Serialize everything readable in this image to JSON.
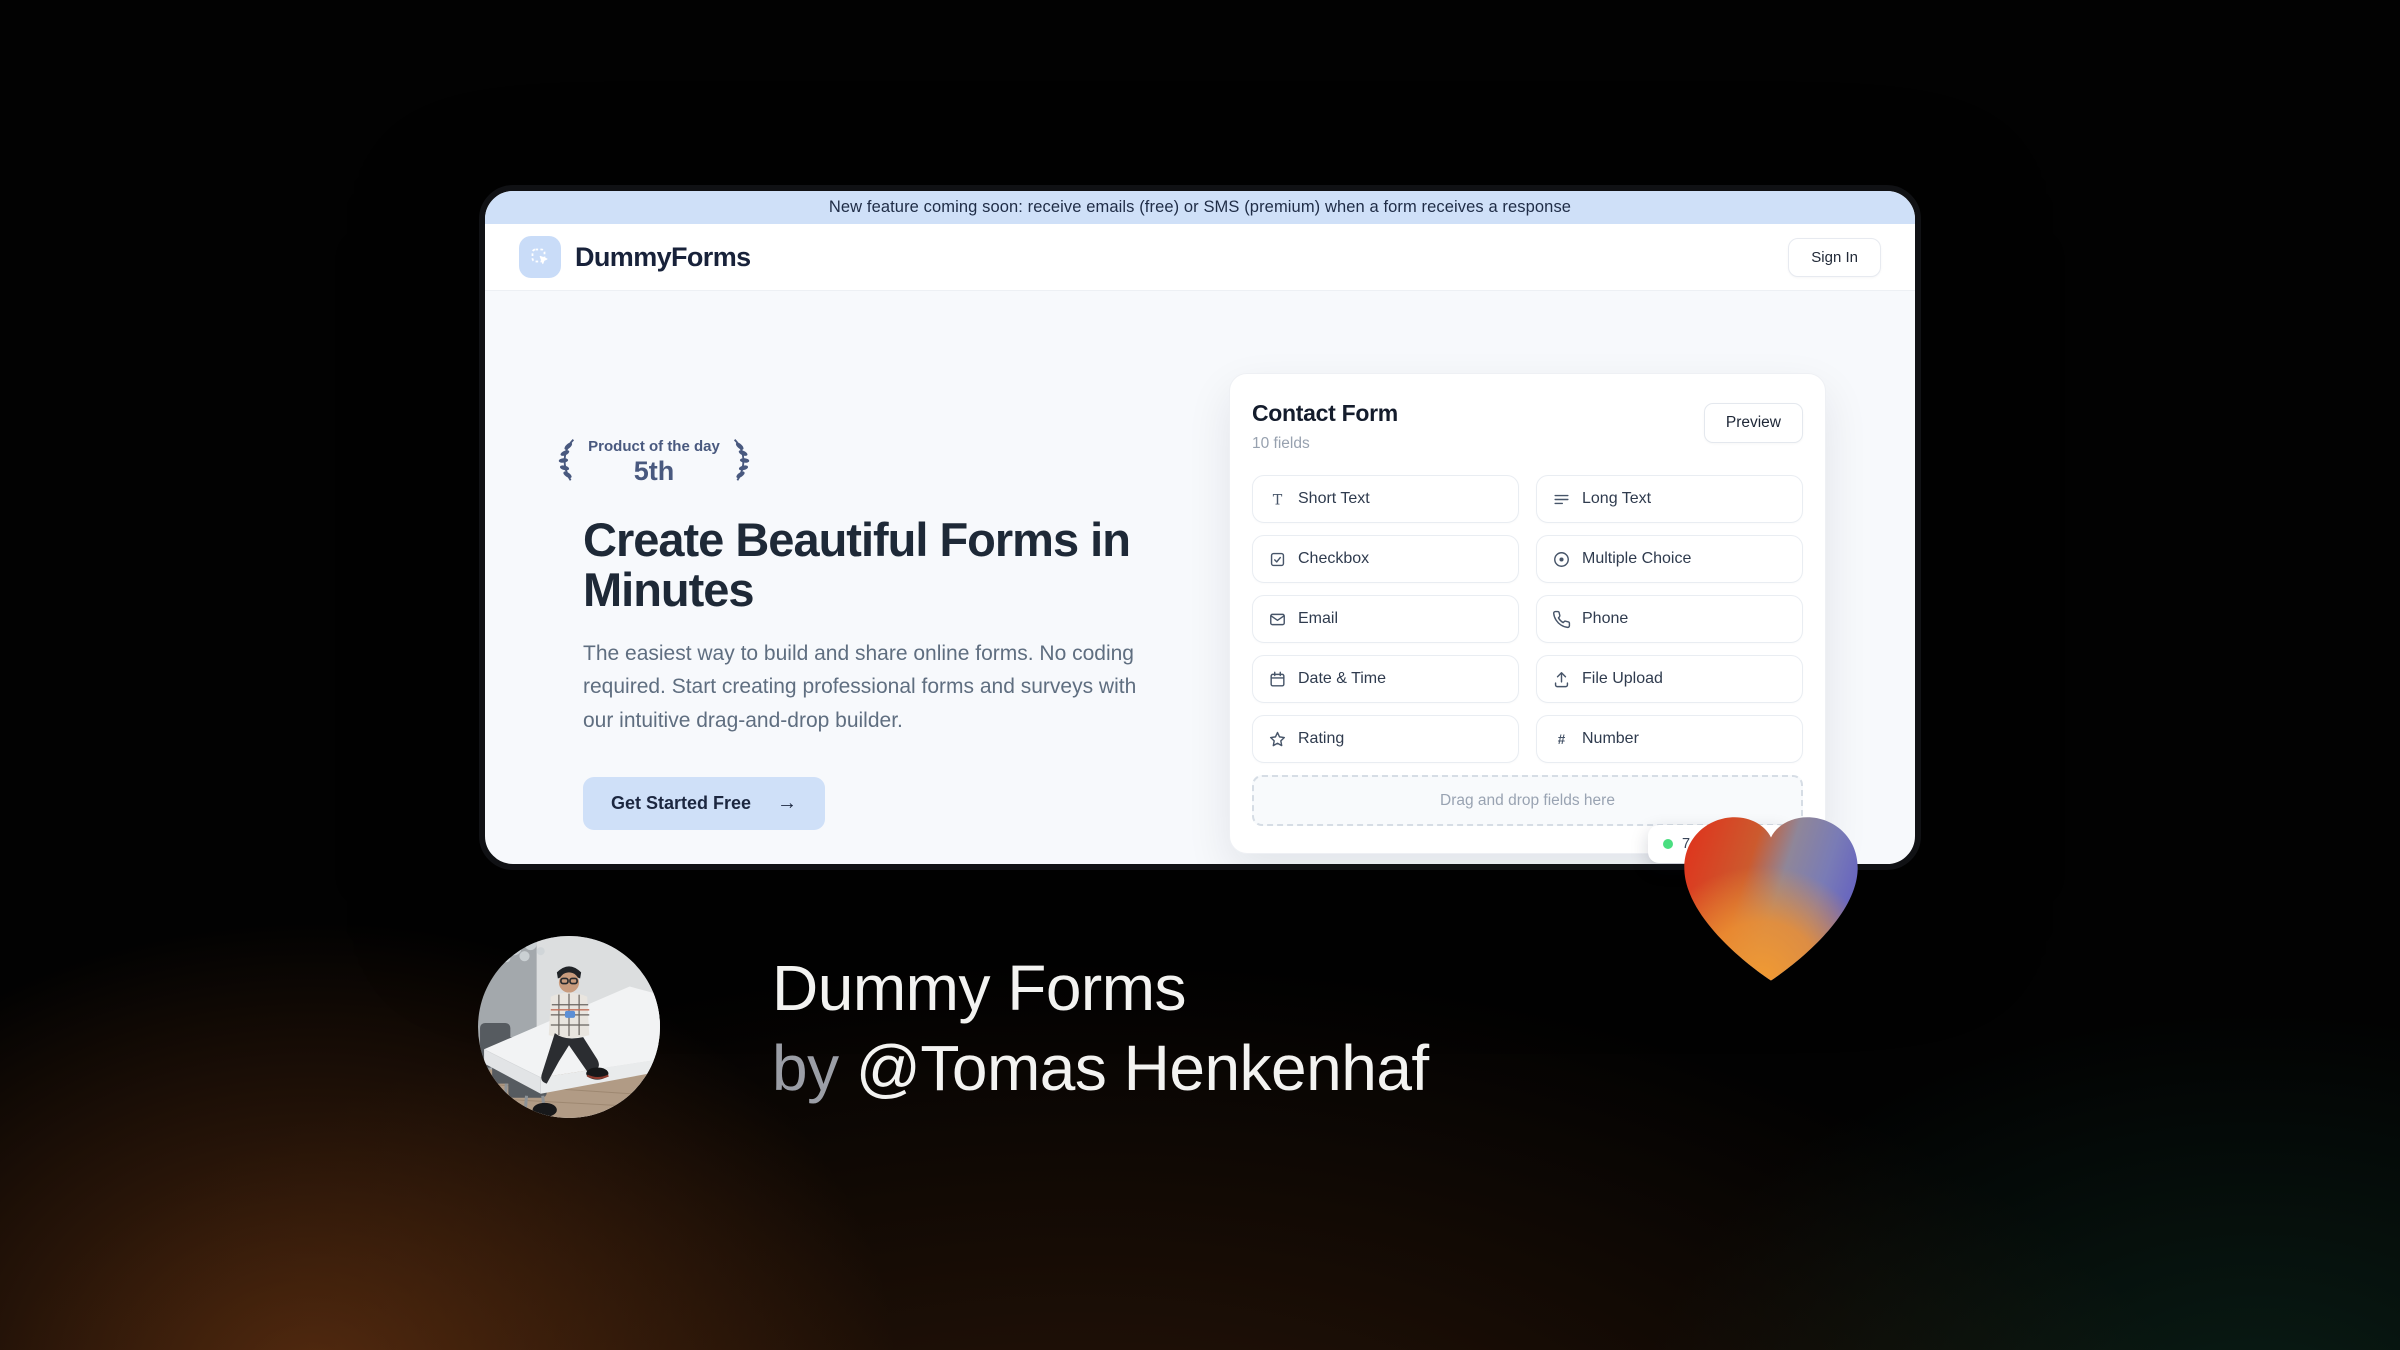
{
  "banner": {
    "text": "New feature coming soon: receive emails (free) or SMS (premium) when a form receives a response"
  },
  "header": {
    "brand": "DummyForms",
    "sign_in_label": "Sign In"
  },
  "hero": {
    "award": {
      "title": "Product of the day",
      "rank": "5th"
    },
    "title": "Create Beautiful Forms in Minutes",
    "description": "The easiest way to build and share online forms. No coding required. Start creating professional forms and surveys with our intuitive drag-and-drop builder.",
    "cta_label": "Get Started Free",
    "cta_arrow": "→"
  },
  "builder": {
    "title": "Contact Form",
    "subtitle": "10 fields",
    "preview_label": "Preview",
    "fields": [
      {
        "label": "Short Text",
        "icon": "short-text-icon"
      },
      {
        "label": "Long Text",
        "icon": "long-text-icon"
      },
      {
        "label": "Checkbox",
        "icon": "checkbox-icon"
      },
      {
        "label": "Multiple Choice",
        "icon": "multiple-choice-icon"
      },
      {
        "label": "Email",
        "icon": "email-icon"
      },
      {
        "label": "Phone",
        "icon": "phone-icon"
      },
      {
        "label": "Date & Time",
        "icon": "calendar-icon"
      },
      {
        "label": "File Upload",
        "icon": "upload-icon"
      },
      {
        "label": "Rating",
        "icon": "star-icon"
      },
      {
        "label": "Number",
        "icon": "hash-icon"
      }
    ],
    "dropzone_text": "Drag and drop fields here",
    "status_badge": {
      "text": "7",
      "dot_color": "#4ade80"
    }
  },
  "caption": {
    "line1": "Dummy Forms",
    "by": "by ",
    "name": "@Tomas Henkenhaf"
  },
  "colors": {
    "accent_light_blue": "#cfe0f8",
    "banner_text": "#1f2c46",
    "heading": "#1e2937",
    "body_text": "#5f6e80",
    "field_icon": "#475569",
    "badge_green": "#4ade80",
    "laurel": "#49597f"
  }
}
